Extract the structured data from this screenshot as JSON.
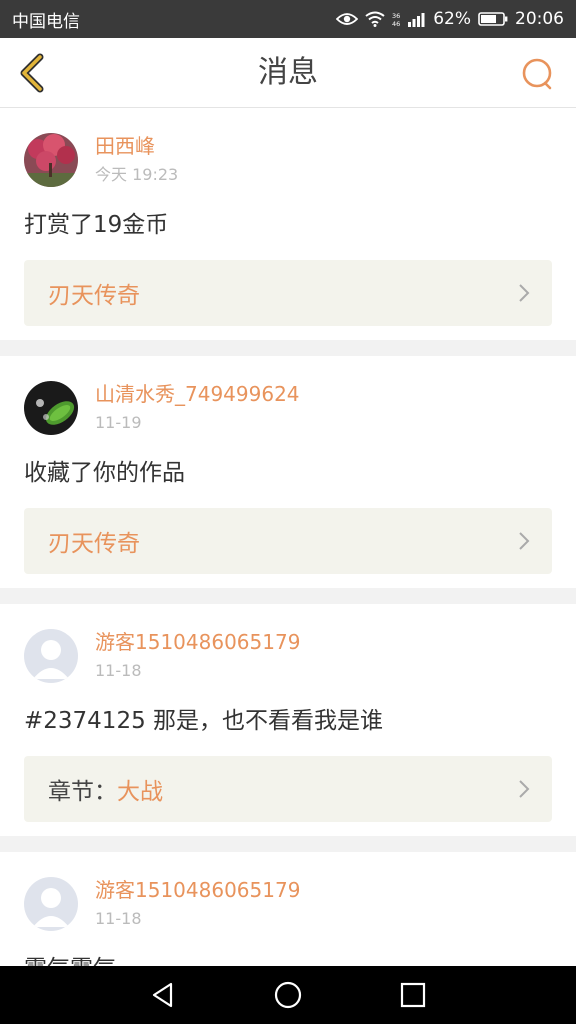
{
  "status_bar": {
    "carrier": "中国电信",
    "signal": "36 46",
    "battery": "62%",
    "time": "20:06"
  },
  "header": {
    "title": "消息",
    "back_icon": "chevron-left-icon",
    "search_icon": "search-icon"
  },
  "colors": {
    "accent": "#e8935c",
    "back_arrow": "#e2b53a"
  },
  "messages": [
    {
      "username": "田西峰",
      "time": "今天 19:23",
      "text": "打赏了19金币",
      "ref_prefix": "",
      "ref_title": "刃天传奇"
    },
    {
      "username": "山清水秀_749499624",
      "time": "11-19",
      "text": "收藏了你的作品",
      "ref_prefix": "",
      "ref_title": "刃天传奇"
    },
    {
      "username": "游客1510486065179",
      "time": "11-18",
      "text": "#2374125 那是，也不看看我是谁",
      "ref_prefix": "章节：",
      "ref_title": "大战"
    },
    {
      "username": "游客1510486065179",
      "time": "11-18",
      "text": "霸气霸气"
    }
  ]
}
